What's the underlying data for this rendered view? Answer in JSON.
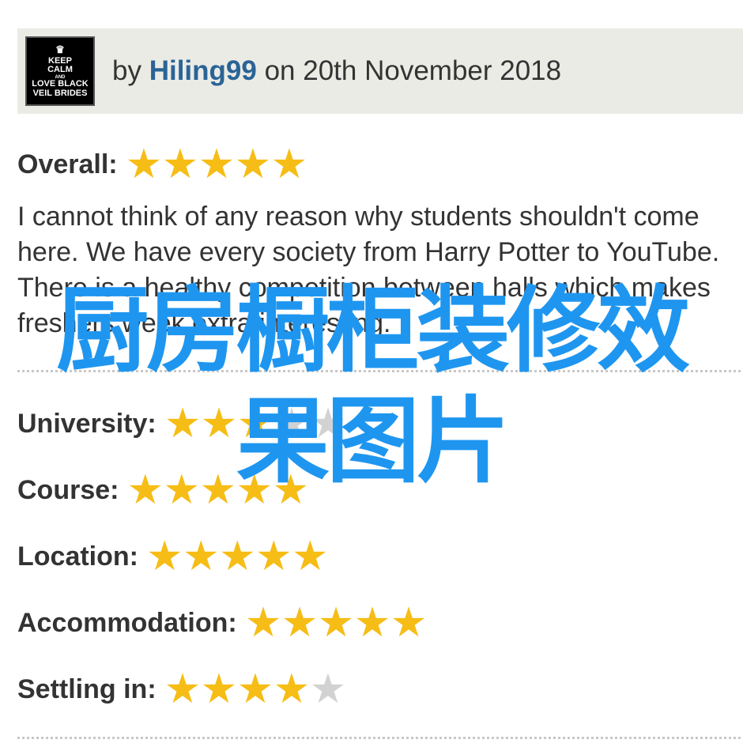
{
  "header": {
    "avatar_lines": [
      "KEEP",
      "CALM",
      "AND",
      "LOVE BLACK",
      "VEIL BRIDES"
    ],
    "by_prefix": "by",
    "username": "Hiling99",
    "date_text": "on 20th November 2018"
  },
  "overall": {
    "label": "Overall:",
    "rating": 5,
    "max": 5
  },
  "review_text": "I cannot think of any reason why students shouldn't come here. We have every society from Harry Potter to YouTube. There is a healthy competition between halls which makes freshers week extra interesting.",
  "ratings": [
    {
      "label": "University:",
      "rating": 3,
      "max": 5
    },
    {
      "label": "Course:",
      "rating": 5,
      "max": 5
    },
    {
      "label": "Location:",
      "rating": 5,
      "max": 5
    },
    {
      "label": "Accommodation:",
      "rating": 5,
      "max": 5
    },
    {
      "label": "Settling in:",
      "rating": 4,
      "max": 5
    }
  ],
  "watermark": {
    "line1": "厨房橱柜装修效",
    "line2": "果图片"
  },
  "colors": {
    "star_on": "#f6bd16",
    "star_off": "#d2d2d2",
    "link": "#2a6496",
    "watermark": "#1e96f0"
  }
}
